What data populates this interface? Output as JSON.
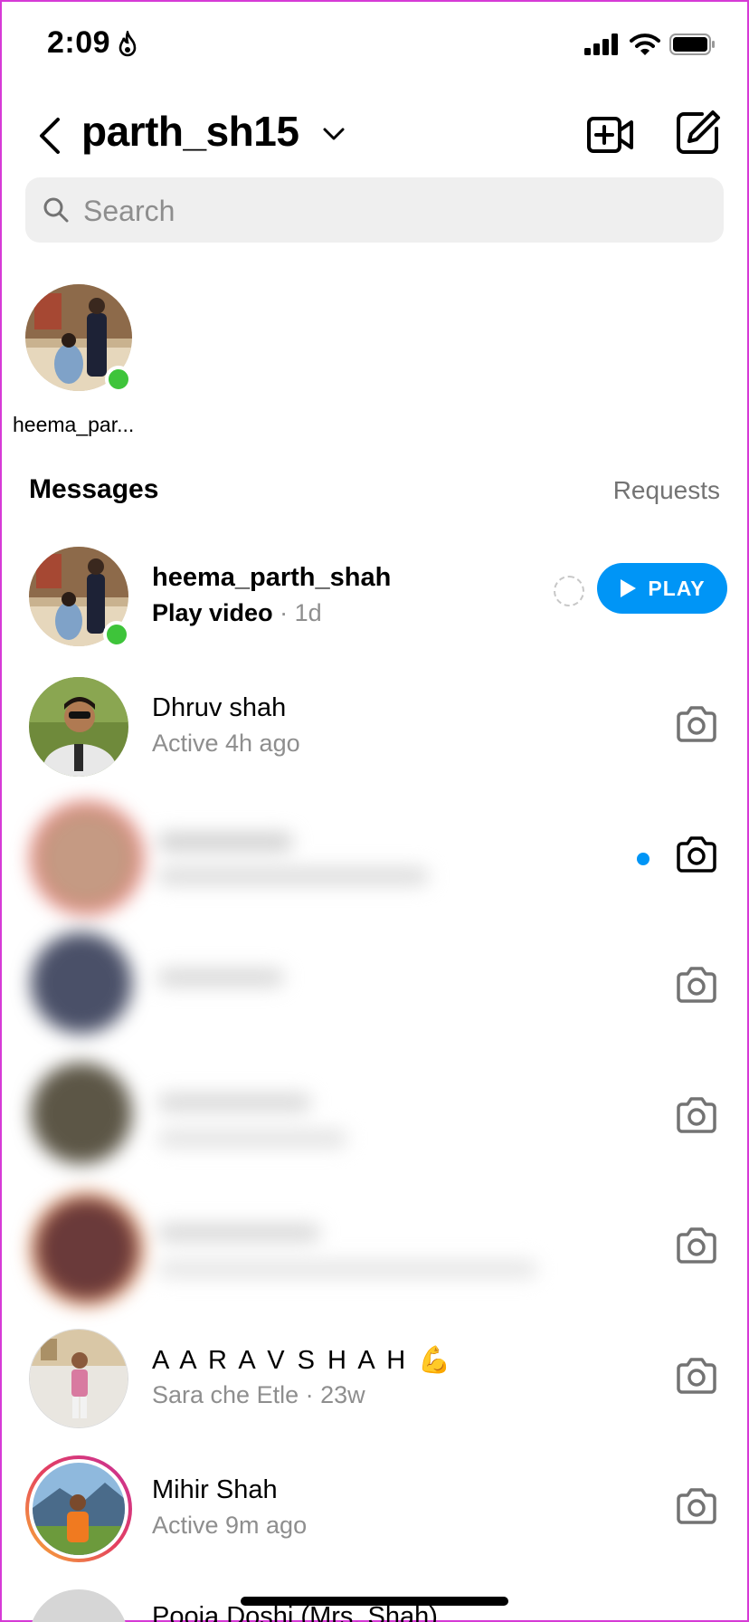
{
  "status": {
    "time": "2:09"
  },
  "header": {
    "account": "parth_sh15"
  },
  "search": {
    "placeholder": "Search"
  },
  "story": {
    "name": "heema_par..."
  },
  "section": {
    "title": "Messages",
    "requests": "Requests"
  },
  "threads": [
    {
      "name": "heema_parth_shah",
      "sub_bold": "Play video",
      "sub_time": "· 1d",
      "action": "PLAY"
    },
    {
      "name": "Dhruv shah",
      "sub": "Active 4h ago"
    },
    {
      "name": "A A R A V   S H A H 💪",
      "sub": "Sara che Etle · 23w"
    },
    {
      "name": "Mihir Shah",
      "sub": "Active 9m ago"
    },
    {
      "name": "Pooja Doshi (Mrs. Shah)"
    }
  ],
  "colors": {
    "accent": "#0095f6",
    "online": "#3ec43a",
    "muted": "#8e8e8e"
  }
}
